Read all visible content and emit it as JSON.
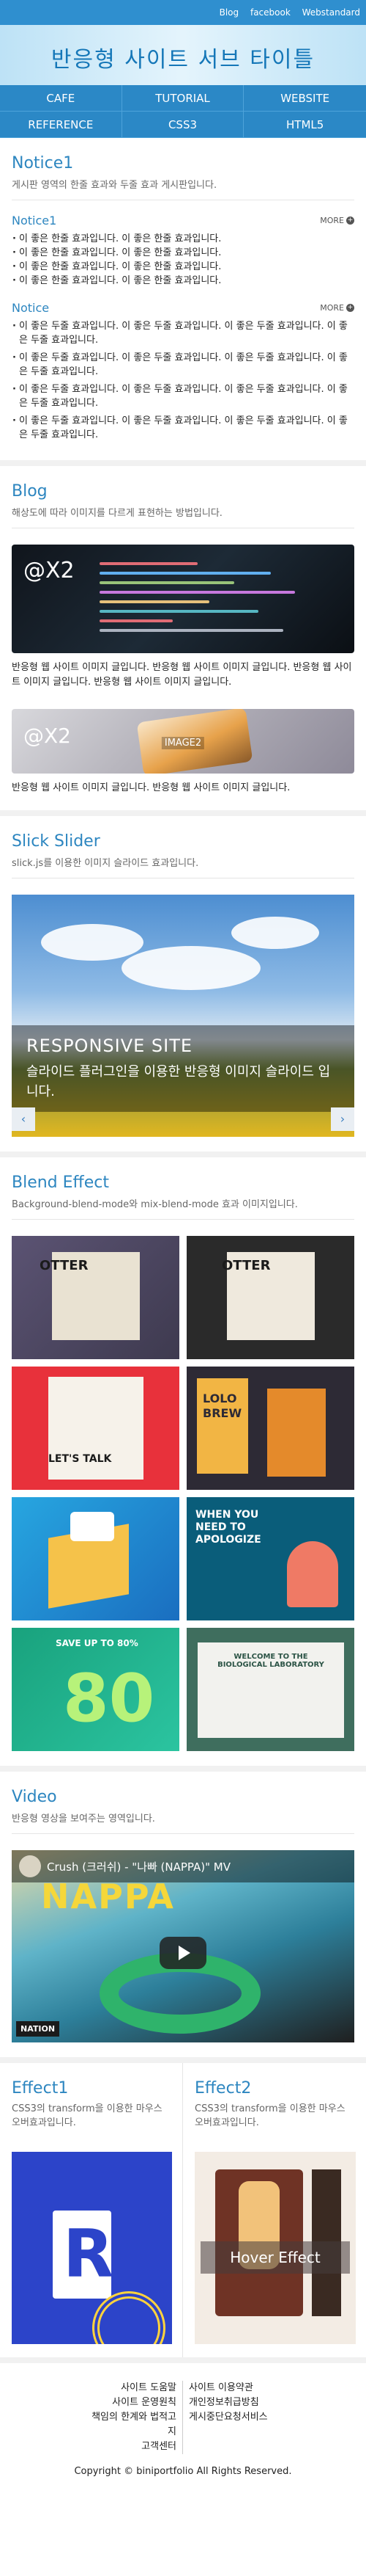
{
  "topbar": {
    "links": [
      "Blog",
      "facebook",
      "Webstandard"
    ]
  },
  "header": {
    "title": "반응형 사이트 서브 타이틀"
  },
  "nav": [
    "CAFE",
    "TUTORIAL",
    "WEBSITE",
    "REFERENCE",
    "CSS3",
    "HTML5"
  ],
  "notice": {
    "title": "Notice1",
    "desc": "게시판 영역의 한줄 효과와 두줄 효과 게시판입니다.",
    "more_label": "MORE",
    "blocks": [
      {
        "label": "Notice1",
        "items": [
          "이 좋은 한줄 효과입니다. 이 좋은 한줄 효과입니다.",
          "이 좋은 한줄 효과입니다. 이 좋은 한줄 효과입니다.",
          "이 좋은 한줄 효과입니다. 이 좋은 한줄 효과입니다.",
          "이 좋은 한줄 효과입니다. 이 좋은 한줄 효과입니다."
        ]
      },
      {
        "label": "Notice",
        "items": [
          "이 좋은 두줄 효과입니다. 이 좋은 두줄 효과입니다. 이 좋은 두줄 효과입니다. 이 좋은 두줄 효과입니다.",
          "이 좋은 두줄 효과입니다. 이 좋은 두줄 효과입니다. 이 좋은 두줄 효과입니다. 이 좋은 두줄 효과입니다.",
          "이 좋은 두줄 효과입니다. 이 좋은 두줄 효과입니다. 이 좋은 두줄 효과입니다. 이 좋은 두줄 효과입니다.",
          "이 좋은 두줄 효과입니다. 이 좋은 두줄 효과입니다. 이 좋은 두줄 효과입니다. 이 좋은 두줄 효과입니다."
        ]
      }
    ]
  },
  "blog": {
    "title": "Blog",
    "desc": "해상도에 따라 이미지를 다르게 표현하는 방법입니다.",
    "posts": [
      {
        "badge": "@X2",
        "text": "반응형 웹 사이트 이미지 글입니다. 반응형 웹 사이트 이미지 글입니다. 반응형 웹 사이트 이미지 글입니다. 반응형 웹 사이트 이미지 글입니다."
      },
      {
        "badge": "@X2",
        "tag": "IMAGE2",
        "text": "반응형 웹 사이트 이미지 글입니다. 반응형 웹 사이트 이미지 글입니다."
      }
    ]
  },
  "slider": {
    "title": "Slick Slider",
    "desc": "slick.js를 이용한 이미지 슬라이드 효과입니다.",
    "caption_title": "RESPONSIVE SITE",
    "caption_text": "슬라이드 플러그인을 이용한 반응형 이미지 슬라이드 입니다.",
    "prev": "‹",
    "next": "›"
  },
  "blend": {
    "title": "Blend Effect",
    "desc": "Background-blend-mode와 mix-blend-mode 효과 이미지입니다.",
    "cells": [
      "OTTER",
      "OTTER",
      "LET'S TALK",
      "LOLO BREW",
      "",
      "WHEN YOU NEED TO APOLOGIZE",
      "SAVE UP TO 80%",
      "WELCOME TO THE BIOLOGICAL LABORATORY"
    ]
  },
  "video": {
    "title": "Video",
    "desc": "반응형 영상을 보여주는 영역입니다.",
    "video_title": "Crush (크러쉬) - \"나빠 (NAPPA)\" MV",
    "overlay_text": "NAPPA",
    "channel_logo": "NATION"
  },
  "effects": [
    {
      "title": "Effect1",
      "desc": "CSS3의 transform을 이용한 마우스 오버효과입니다."
    },
    {
      "title": "Effect2",
      "desc": "CSS3의 transform을 이용한 마우스 오버효과입니다.",
      "hover_label": "Hover Effect"
    }
  ],
  "footer": {
    "links": [
      "사이트 도움말",
      "사이트 이용약관",
      "사이트 운영원칙",
      "개인정보취급방침",
      "책임의 한계와 법적고지",
      "게시중단요청서비스",
      "고객센터",
      ""
    ],
    "copyright": "Copyright © biniportfolio All Rights Reserved."
  },
  "colors": {
    "accent": "#2d86c0",
    "topbar": "#2f8fcf",
    "nav": "#2b88c6"
  }
}
